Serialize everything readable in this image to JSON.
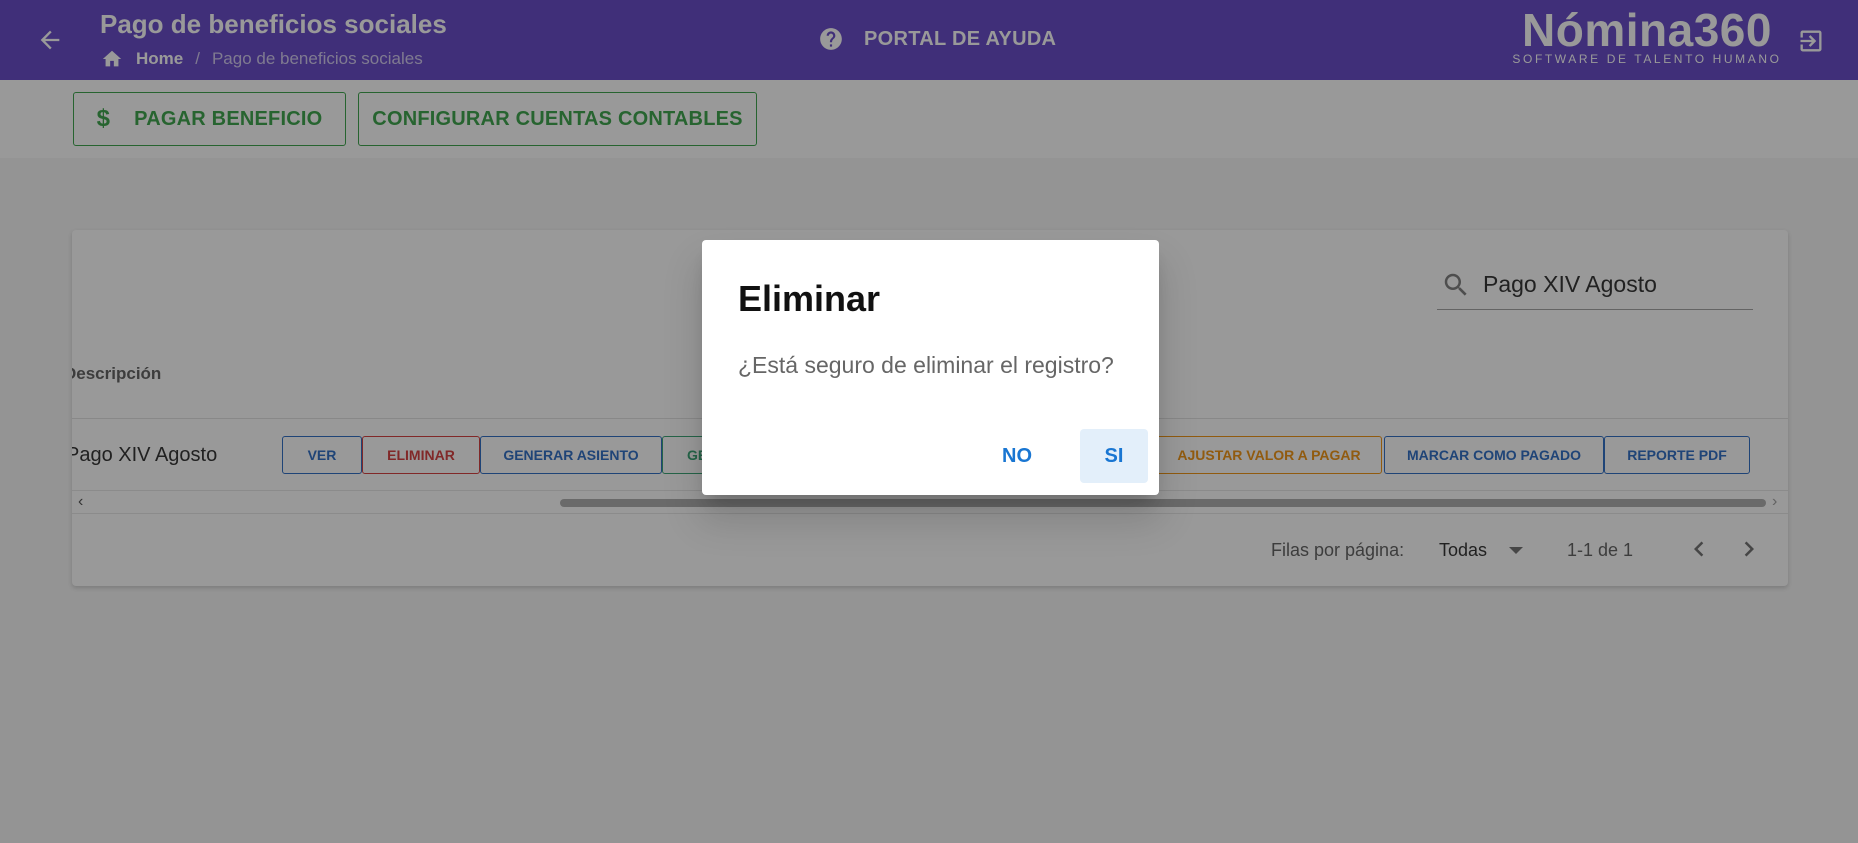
{
  "header": {
    "title": "Pago de beneficios sociales",
    "breadcrumb_home": "Home",
    "breadcrumb_separator": "/",
    "breadcrumb_current": "Pago de beneficios sociales",
    "help_label": "PORTAL DE AYUDA",
    "logo_main": "Nómina360",
    "logo_sub": "SOFTWARE DE TALENTO HUMANO",
    "color": "#5b3cc4"
  },
  "toolbar": {
    "pay_label": "PAGAR BENEFICIO",
    "config_label": "CONFIGURAR CUENTAS CONTABLES",
    "pay_icon": "$"
  },
  "table": {
    "search_value": "Pago XIV Agosto",
    "column_description": "Descripción",
    "rows": [
      {
        "description": "Pago XIV Agosto",
        "actions": {
          "ver": "VER",
          "eliminar": "ELIMINAR",
          "generar_asiento": "GENERAR ASIENTO",
          "ge_partial": "GE",
          "ajustar": "AJUSTAR VALOR A PAGAR",
          "marcar": "MARCAR COMO PAGADO",
          "reporte": "REPORTE PDF"
        }
      }
    ],
    "rows_per_page_label": "Filas por página:",
    "rows_per_page_value": "Todas",
    "range": "1-1 de 1"
  },
  "dialog": {
    "title": "Eliminar",
    "text": "¿Está seguro de eliminar el registro?",
    "no_label": "NO",
    "si_label": "SI"
  }
}
